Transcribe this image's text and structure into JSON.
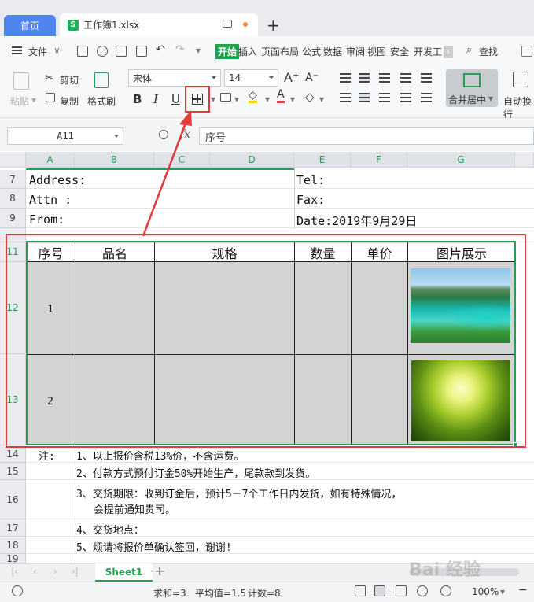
{
  "tabs": {
    "home": "首页",
    "doc": "工作簿1.xlsx"
  },
  "menu": {
    "file": "文件",
    "start": "开始",
    "items": [
      "插入",
      "页面布局",
      "公式",
      "数据",
      "审阅",
      "视图",
      "安全",
      "开发工"
    ],
    "search": "查找"
  },
  "ribbon": {
    "paste": "粘贴",
    "cut": "剪切",
    "copy": "复制",
    "format_painter": "格式刷",
    "font_name": "宋体",
    "font_size": "14",
    "bold": "B",
    "italic": "I",
    "underline": "U",
    "merge_center": "合并居中",
    "auto_wrap": "自动换行"
  },
  "formula_bar": {
    "cell_ref": "A11",
    "fx": "fx",
    "content": "序号"
  },
  "columns": [
    "A",
    "B",
    "C",
    "D",
    "E",
    "F",
    "G"
  ],
  "rows": [
    "7",
    "8",
    "9",
    "11",
    "12",
    "13",
    "14",
    "15",
    "16",
    "17",
    "18",
    "19"
  ],
  "cells": {
    "address": "Address:",
    "tel": "Tel:",
    "attn": "Attn :",
    "fax": "Fax:",
    "from": "From:",
    "date": "Date:2019年9月29日",
    "header": [
      "序号",
      "品名",
      "规格",
      "数量",
      "单价",
      "图片展示"
    ],
    "row1_no": "1",
    "row2_no": "2",
    "note_label": "注:",
    "notes": [
      "1、以上报价含税13%价，不含运费。",
      "2、付款方式预付订金50%开始生产，尾款款到发货。",
      "3、交货期限：收到订金后，预计5－7个工作日内发货，如有特殊情况，",
      "会提前通知贵司。",
      "4、交货地点：",
      "5、烦请将报价单确认签回，谢谢!"
    ]
  },
  "sheet": {
    "name": "Sheet1"
  },
  "status": {
    "sum": "求和=3",
    "avg": "平均值=1.5",
    "count": "计数=8",
    "zoom": "100%"
  },
  "watermark": "Bai 经验",
  "colors": {
    "accent_green": "#1fa14d",
    "highlight_red": "#e33a3a",
    "home_tab_blue": "#4d84f0"
  }
}
